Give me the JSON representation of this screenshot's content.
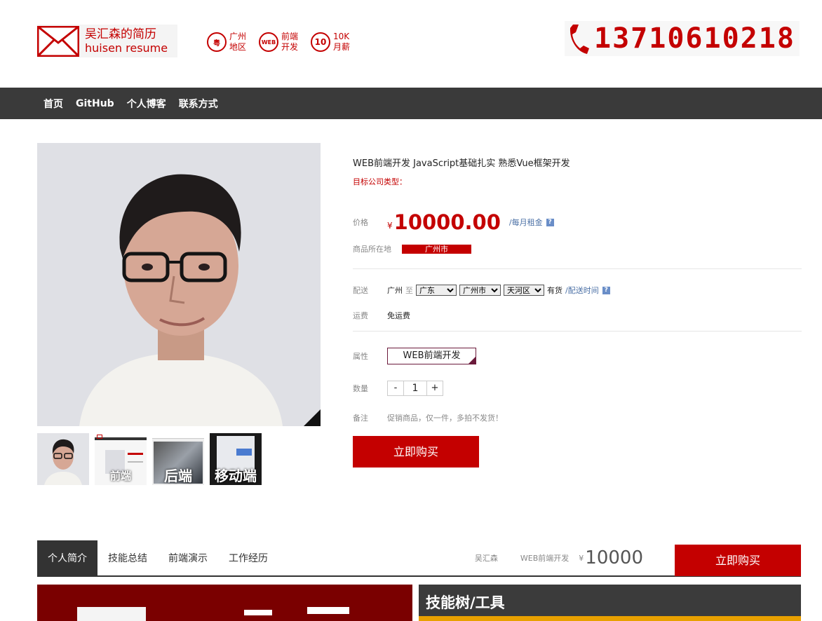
{
  "header": {
    "logo_line1": "吴汇森的简历",
    "logo_line2": "huisen resume",
    "badges": [
      {
        "icon": "粤",
        "text1": "广州",
        "text2": "地区"
      },
      {
        "icon": "WEB",
        "text1": "前端",
        "text2": "开发"
      },
      {
        "icon": "10",
        "text1": "10K",
        "text2": "月薪"
      }
    ],
    "phone": "13710610218"
  },
  "nav": [
    "首页",
    "GitHub",
    "个人博客",
    "联系方式"
  ],
  "thumbs": [
    "",
    "前端",
    "后端",
    "移动端"
  ],
  "product": {
    "title": "WEB前端开发 JavaScript基础扎实 熟悉Vue框架开发",
    "subtitle": "目标公司类型：",
    "price_label": "价格",
    "currency": "¥",
    "price": "10000.00",
    "monthly": "/每月租金",
    "help": "?",
    "location_label": "商品所在地",
    "location": "广州市",
    "delivery_label": "配送",
    "delivery_from": "广州",
    "delivery_to": "至",
    "province": "广东",
    "city": "广州市",
    "district": "天河区",
    "stock": "有货",
    "delivery_time": "/配送时间",
    "shipping_label": "运费",
    "shipping": "免运费",
    "attr_label": "属性",
    "attr": "WEB前端开发",
    "qty_label": "数量",
    "qty_minus": "-",
    "qty": "1",
    "qty_plus": "+",
    "note_label": "备注",
    "note": "促销商品，仅一件，多拍不发货！",
    "buy": "立即购买"
  },
  "tabs": [
    "个人简介",
    "技能总结",
    "前端演示",
    "工作经历"
  ],
  "tabbar_right": {
    "name": "吴汇森",
    "role": "WEB前端开发",
    "currency": "¥",
    "price": "10000",
    "buy": "立即购买"
  },
  "bottom": {
    "right_heading": "技能树/工具"
  },
  "colors": {
    "accent": "#c40000",
    "nav_bg": "#3a3a3a",
    "link": "#4a6fa5"
  }
}
